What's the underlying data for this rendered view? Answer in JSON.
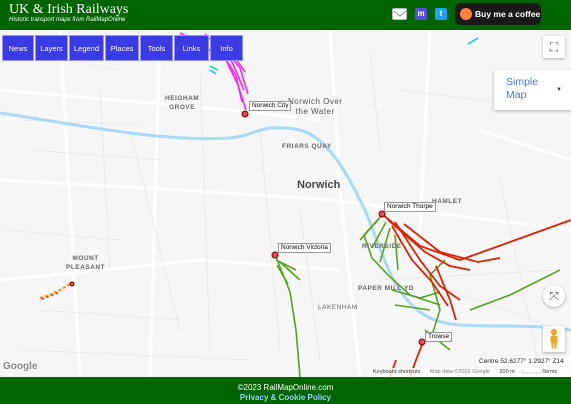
{
  "header": {
    "title": "UK & Irish Railways",
    "subtitle": "Historic transport maps from RailMapOnline",
    "coffee_label": "Buy me a coffee",
    "mastodon_glyph": "m",
    "twitter_glyph": "t",
    "social_icons": [
      "mail-icon",
      "mastodon-icon",
      "twitter-icon",
      "coffee-cup-icon"
    ]
  },
  "nav": {
    "news": "News",
    "layers": "Layers",
    "legend": "Legend",
    "places": "Places",
    "tools": "Tools",
    "links": "Links",
    "info": "Info"
  },
  "map": {
    "type_label_1": "Simple",
    "type_label_2": "Map",
    "fullscreen_glyph": "⛶",
    "pan_glyph": "⤧",
    "zoom_in": "+",
    "zoom_out": "−",
    "pegman_icon": "pegman-icon",
    "place_labels": {
      "heigham_1": "HEIGHAM",
      "heigham_2": "GROVE",
      "over_water_1": "Norwich Over",
      "over_water_2": "the Water",
      "friars_quay": "FRIARS QUAY",
      "norwich": "Norwich",
      "mount_1": "MOUNT",
      "mount_2": "PLEASANT",
      "riverside": "RIVERSIDE",
      "paper_mill": "PAPER MILL YD",
      "lakenham": "LAKENHAM",
      "thorpe_hamlet": "HAMLET"
    },
    "stations": {
      "norwich_city": "Norwich City",
      "norwich_thorpe": "Norwich Thorpe",
      "norwich_victoria": "Norwich Victoria",
      "trowse": "Trowse"
    },
    "coords": "Centre 52.6277° 1.2927° Z14",
    "google_logo": "Google",
    "keyboard_shortcuts": "Keyboard shortcuts",
    "map_data": "Map data ©2025 Google",
    "scale": "200 m",
    "terms": "Terms",
    "colors": {
      "green_line": "#55a51c",
      "magenta_line": "#ff22ff",
      "red_line": "#dd2200",
      "orange_line": "#ff8c00",
      "water": "#a8daf7"
    }
  },
  "footer": {
    "copyright": "©2023 RailMapOnline.com",
    "privacy": "Privacy & Cookie Policy"
  }
}
